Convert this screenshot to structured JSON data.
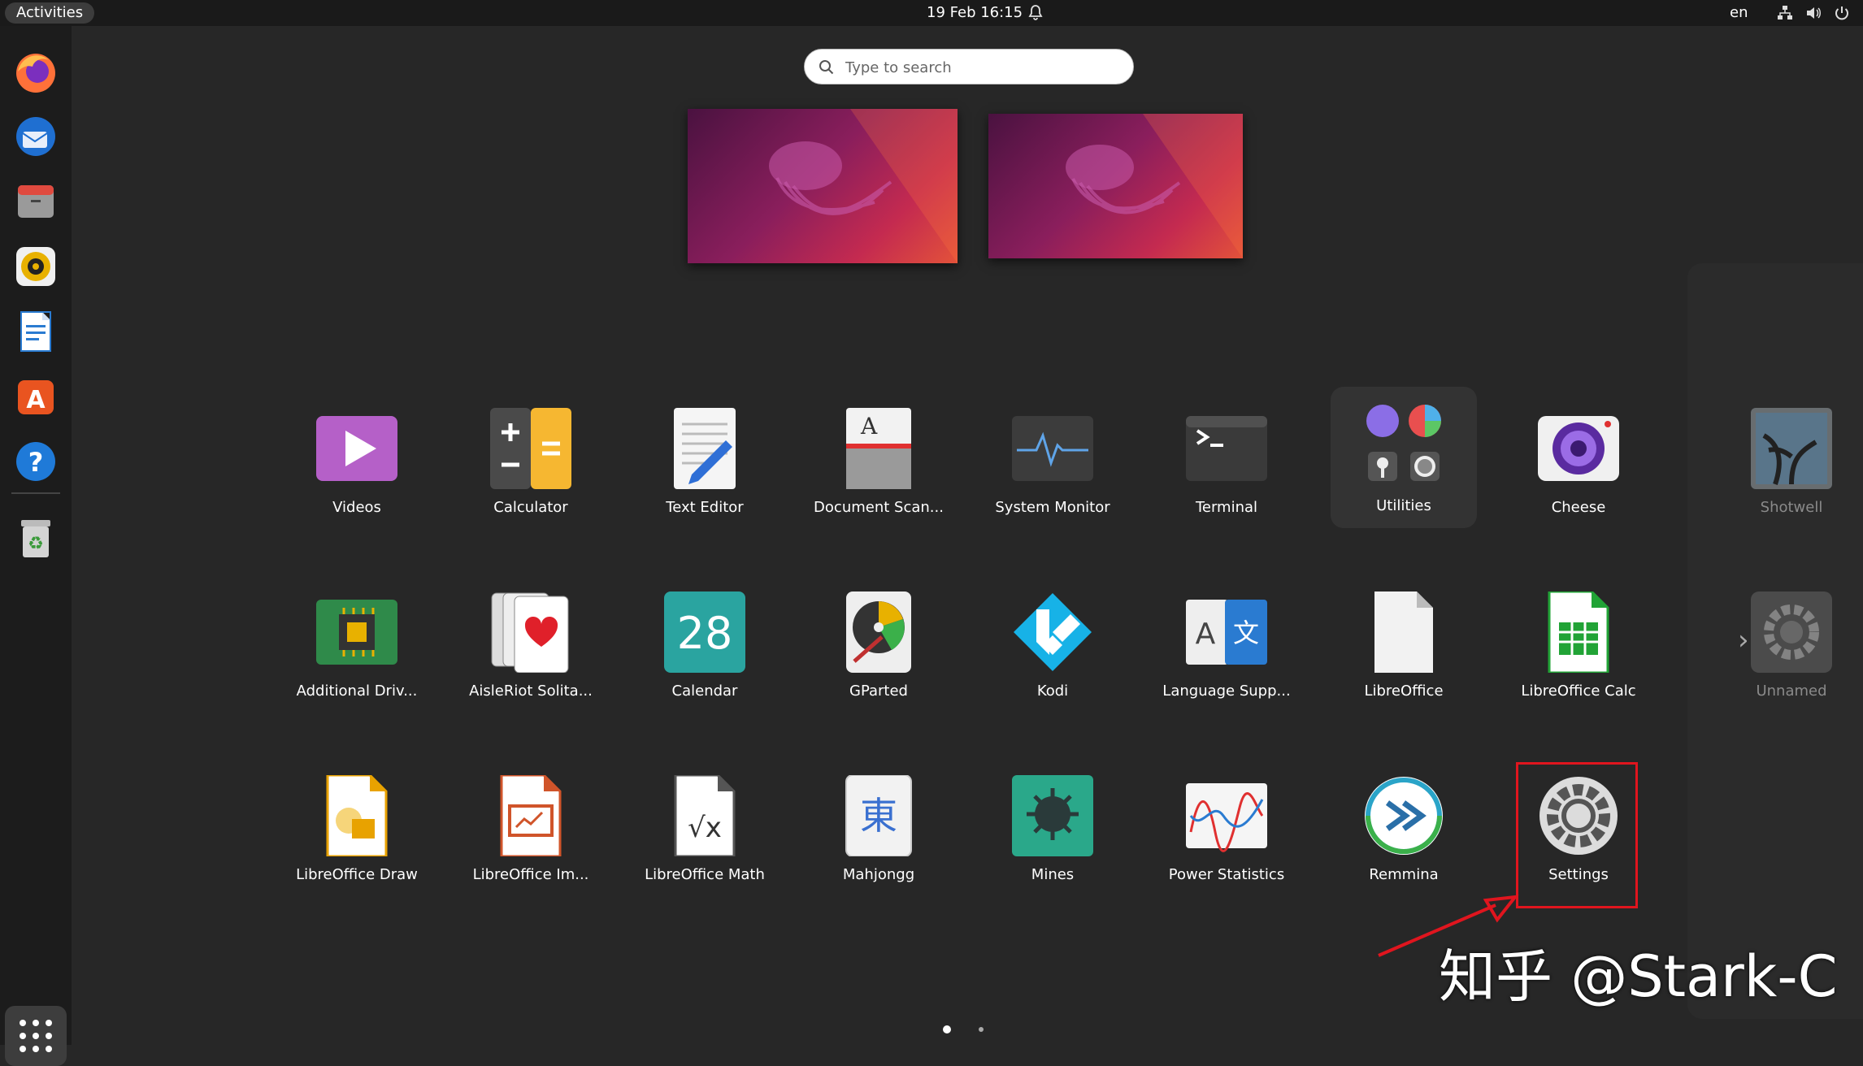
{
  "topbar": {
    "activities": "Activities",
    "clock": "19 Feb  16:15",
    "lang": "en"
  },
  "search": {
    "placeholder": "Type to search"
  },
  "apps": [
    {
      "label": "Videos",
      "icon": "videos-icon"
    },
    {
      "label": "Calculator",
      "icon": "calculator-icon"
    },
    {
      "label": "Text Editor",
      "icon": "text-editor-icon"
    },
    {
      "label": "Document Scan...",
      "icon": "document-scanner-icon"
    },
    {
      "label": "System Monitor",
      "icon": "system-monitor-icon"
    },
    {
      "label": "Terminal",
      "icon": "terminal-icon"
    },
    {
      "label": "Utilities",
      "icon": "utilities-folder-icon"
    },
    {
      "label": "Cheese",
      "icon": "cheese-icon"
    },
    {
      "label": "Shotwell",
      "icon": "shotwell-icon"
    },
    {
      "label": "Additional Driv...",
      "icon": "additional-drivers-icon"
    },
    {
      "label": "AisleRiot Solita...",
      "icon": "aisleriot-icon"
    },
    {
      "label": "Calendar",
      "icon": "calendar-icon",
      "day": "28"
    },
    {
      "label": "GParted",
      "icon": "gparted-icon"
    },
    {
      "label": "Kodi",
      "icon": "kodi-icon"
    },
    {
      "label": "Language Supp...",
      "icon": "language-support-icon"
    },
    {
      "label": "LibreOffice",
      "icon": "libreoffice-icon"
    },
    {
      "label": "LibreOffice Calc",
      "icon": "libreoffice-calc-icon"
    },
    {
      "label": "Unnamed",
      "icon": "unnamed-gear-icon"
    },
    {
      "label": "LibreOffice Draw",
      "icon": "libreoffice-draw-icon"
    },
    {
      "label": "LibreOffice Im...",
      "icon": "libreoffice-impress-icon"
    },
    {
      "label": "LibreOffice Math",
      "icon": "libreoffice-math-icon"
    },
    {
      "label": "Mahjongg",
      "icon": "mahjongg-icon",
      "glyph": "東"
    },
    {
      "label": "Mines",
      "icon": "mines-icon"
    },
    {
      "label": "Power Statistics",
      "icon": "power-statistics-icon"
    },
    {
      "label": "Remmina",
      "icon": "remmina-icon"
    },
    {
      "label": "Settings",
      "icon": "settings-icon"
    }
  ],
  "watermark": "知乎 @Stark-C",
  "colors": {
    "highlight": "#e0151e",
    "accent": "#e95420"
  }
}
